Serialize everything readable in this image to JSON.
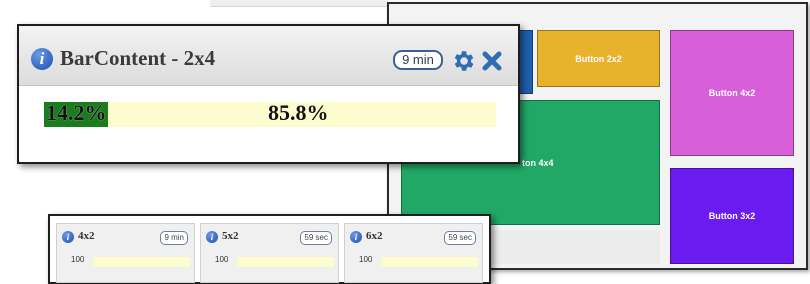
{
  "dashboard": {
    "tiles": [
      {
        "label": ""
      },
      {
        "label": "Button 2x2"
      },
      {
        "label": "ton 4x4"
      },
      {
        "label": "Button 4x2"
      },
      {
        "label": "Button 3x2"
      }
    ],
    "colors": {
      "blue": "#1f5fae",
      "yellow": "#e8b22c",
      "green": "#21a866",
      "magenta": "#d75fd9",
      "violet": "#6a1cf0"
    }
  },
  "widget": {
    "title": "BarContent - 2x4",
    "time_badge": "9 min",
    "info_icon": "i",
    "progress": {
      "left_label": "14.2%",
      "right_label": "85.8%",
      "fill_fraction": 0.142
    },
    "colors": {
      "fill": "#1b7c1e",
      "track": "#fdfccf"
    }
  },
  "mini_widgets": [
    {
      "title": "4x2",
      "badge": "9 min",
      "value": "100",
      "info_icon": "i"
    },
    {
      "title": "5x2",
      "badge": "59 sec",
      "value": "100",
      "info_icon": "i"
    },
    {
      "title": "6x2",
      "badge": "59 sec",
      "value": "100",
      "info_icon": "i"
    }
  ]
}
